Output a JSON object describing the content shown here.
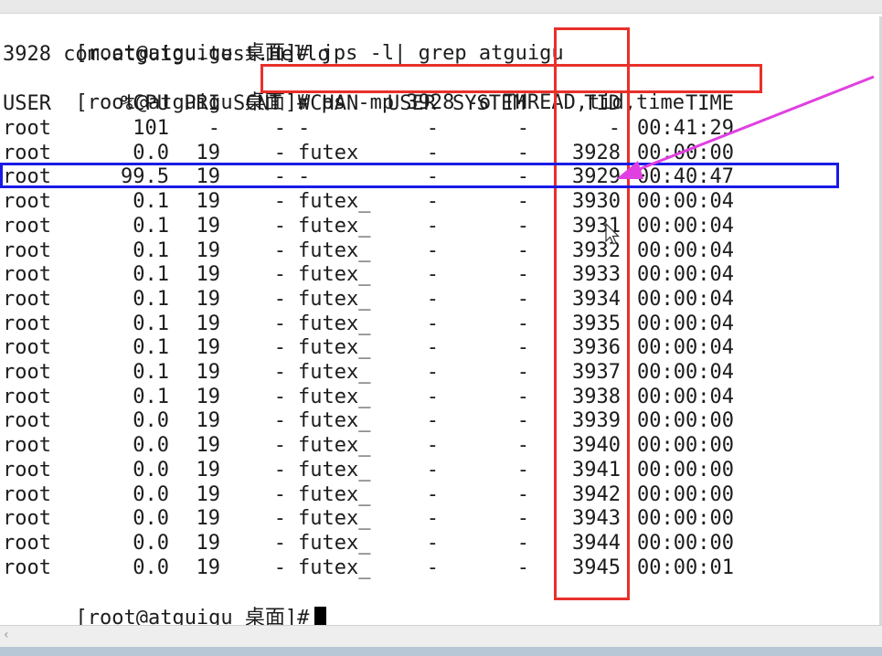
{
  "terminal": {
    "prompt": "[root@atguigu 桌面]#",
    "command1": " jps -l| grep atguigu",
    "jps_output": "3928 com.atguigu.test.Hello",
    "command2": "ps -mp 3928 -o THREAD,tid,time",
    "headers": {
      "user": "USER",
      "cpu": "%CPU",
      "pri": "PRI",
      "scnt": "SCNT",
      "wchan": "WCHAN",
      "user2": "USER",
      "system": "SYSTEM",
      "tid": "TID",
      "time": "TIME"
    },
    "rows": [
      {
        "user": "root",
        "cpu": "101",
        "pri": "-",
        "scnt": "-",
        "wchan": "-",
        "user2": "-",
        "system": "-",
        "tid": "-",
        "time": "00:41:29"
      },
      {
        "user": "root",
        "cpu": "0.0",
        "pri": "19",
        "scnt": "-",
        "wchan": "futex",
        "user2": "-",
        "system": "-",
        "tid": "3928",
        "time": "00:00:00"
      },
      {
        "user": "root",
        "cpu": "99.5",
        "pri": "19",
        "scnt": "-",
        "wchan": "-",
        "user2": "-",
        "system": "-",
        "tid": "3929",
        "time": "00:40:47"
      },
      {
        "user": "root",
        "cpu": "0.1",
        "pri": "19",
        "scnt": "-",
        "wchan": "futex_",
        "user2": "-",
        "system": "-",
        "tid": "3930",
        "time": "00:00:04"
      },
      {
        "user": "root",
        "cpu": "0.1",
        "pri": "19",
        "scnt": "-",
        "wchan": "futex_",
        "user2": "-",
        "system": "-",
        "tid": "3931",
        "time": "00:00:04"
      },
      {
        "user": "root",
        "cpu": "0.1",
        "pri": "19",
        "scnt": "-",
        "wchan": "futex_",
        "user2": "-",
        "system": "-",
        "tid": "3932",
        "time": "00:00:04"
      },
      {
        "user": "root",
        "cpu": "0.1",
        "pri": "19",
        "scnt": "-",
        "wchan": "futex_",
        "user2": "-",
        "system": "-",
        "tid": "3933",
        "time": "00:00:04"
      },
      {
        "user": "root",
        "cpu": "0.1",
        "pri": "19",
        "scnt": "-",
        "wchan": "futex_",
        "user2": "-",
        "system": "-",
        "tid": "3934",
        "time": "00:00:04"
      },
      {
        "user": "root",
        "cpu": "0.1",
        "pri": "19",
        "scnt": "-",
        "wchan": "futex_",
        "user2": "-",
        "system": "-",
        "tid": "3935",
        "time": "00:00:04"
      },
      {
        "user": "root",
        "cpu": "0.1",
        "pri": "19",
        "scnt": "-",
        "wchan": "futex_",
        "user2": "-",
        "system": "-",
        "tid": "3936",
        "time": "00:00:04"
      },
      {
        "user": "root",
        "cpu": "0.1",
        "pri": "19",
        "scnt": "-",
        "wchan": "futex_",
        "user2": "-",
        "system": "-",
        "tid": "3937",
        "time": "00:00:04"
      },
      {
        "user": "root",
        "cpu": "0.1",
        "pri": "19",
        "scnt": "-",
        "wchan": "futex_",
        "user2": "-",
        "system": "-",
        "tid": "3938",
        "time": "00:00:04"
      },
      {
        "user": "root",
        "cpu": "0.0",
        "pri": "19",
        "scnt": "-",
        "wchan": "futex_",
        "user2": "-",
        "system": "-",
        "tid": "3939",
        "time": "00:00:00"
      },
      {
        "user": "root",
        "cpu": "0.0",
        "pri": "19",
        "scnt": "-",
        "wchan": "futex_",
        "user2": "-",
        "system": "-",
        "tid": "3940",
        "time": "00:00:00"
      },
      {
        "user": "root",
        "cpu": "0.0",
        "pri": "19",
        "scnt": "-",
        "wchan": "futex_",
        "user2": "-",
        "system": "-",
        "tid": "3941",
        "time": "00:00:00"
      },
      {
        "user": "root",
        "cpu": "0.0",
        "pri": "19",
        "scnt": "-",
        "wchan": "futex_",
        "user2": "-",
        "system": "-",
        "tid": "3942",
        "time": "00:00:00"
      },
      {
        "user": "root",
        "cpu": "0.0",
        "pri": "19",
        "scnt": "-",
        "wchan": "futex_",
        "user2": "-",
        "system": "-",
        "tid": "3943",
        "time": "00:00:00"
      },
      {
        "user": "root",
        "cpu": "0.0",
        "pri": "19",
        "scnt": "-",
        "wchan": "futex_",
        "user2": "-",
        "system": "-",
        "tid": "3944",
        "time": "00:00:00"
      },
      {
        "user": "root",
        "cpu": "0.0",
        "pri": "19",
        "scnt": "-",
        "wchan": "futex_",
        "user2": "-",
        "system": "-",
        "tid": "3945",
        "time": "00:00:01"
      }
    ]
  },
  "scrollbar": {
    "left_arrow": "‹"
  },
  "colors": {
    "red_highlight": "#e8302a",
    "blue_highlight": "#1a1ae6",
    "magenta_arrow": "#e040e0",
    "text": "#1c1c1c"
  }
}
